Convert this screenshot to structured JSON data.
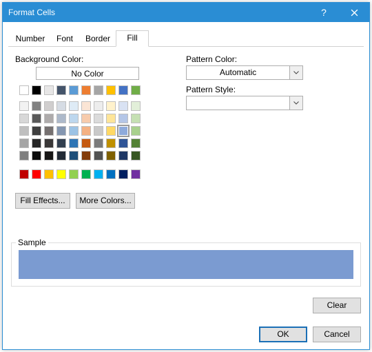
{
  "window": {
    "title": "Format Cells"
  },
  "tabs": {
    "number": "Number",
    "font": "Font",
    "border": "Border",
    "fill": "Fill"
  },
  "fill": {
    "bg_label": "Background Color:",
    "no_color": "No Color",
    "pattern_color_label": "Pattern Color:",
    "pattern_color_value": "Automatic",
    "pattern_style_label": "Pattern Style:",
    "pattern_style_value": "",
    "fill_effects": "Fill Effects...",
    "more_colors": "More Colors...",
    "sample_label": "Sample",
    "sample_color": "#7b9bd1"
  },
  "palette": {
    "theme_row": [
      "#FFFFFF",
      "#000000",
      "#E7E6E6",
      "#44546A",
      "#5B9BD5",
      "#ED7D31",
      "#A5A5A5",
      "#FFC000",
      "#4472C4",
      "#70AD47"
    ],
    "tints": [
      [
        "#F2F2F2",
        "#808080",
        "#D0CECE",
        "#D6DCE4",
        "#DEEBF6",
        "#FBE5D5",
        "#EDEDED",
        "#FFF2CC",
        "#D9E2F3",
        "#E2EFD9"
      ],
      [
        "#D8D8D8",
        "#595959",
        "#AEABAB",
        "#ADB9CA",
        "#BDD7EE",
        "#F7CBAC",
        "#DBDBDB",
        "#FEE599",
        "#B4C6E7",
        "#C5E0B3"
      ],
      [
        "#BFBFBF",
        "#3F3F3F",
        "#757070",
        "#8496B0",
        "#9CC3E5",
        "#F4B183",
        "#C9C9C9",
        "#FFD965",
        "#8EAADB",
        "#A8D08D"
      ],
      [
        "#A5A5A5",
        "#262626",
        "#3A3838",
        "#323F4F",
        "#2E75B5",
        "#C55A11",
        "#7B7B7B",
        "#BF9000",
        "#2F5496",
        "#538135"
      ],
      [
        "#7F7F7F",
        "#0C0C0C",
        "#171616",
        "#222A35",
        "#1E4E79",
        "#833C0B",
        "#525252",
        "#7F6000",
        "#1F3864",
        "#375623"
      ]
    ],
    "standard_row": [
      "#C00000",
      "#FF0000",
      "#FFC000",
      "#FFFF00",
      "#92D050",
      "#00B050",
      "#00B0F0",
      "#0070C0",
      "#002060",
      "#7030A0"
    ],
    "selected": {
      "group": "tints",
      "row": 2,
      "col": 8
    }
  },
  "buttons": {
    "clear": "Clear",
    "ok": "OK",
    "cancel": "Cancel"
  }
}
